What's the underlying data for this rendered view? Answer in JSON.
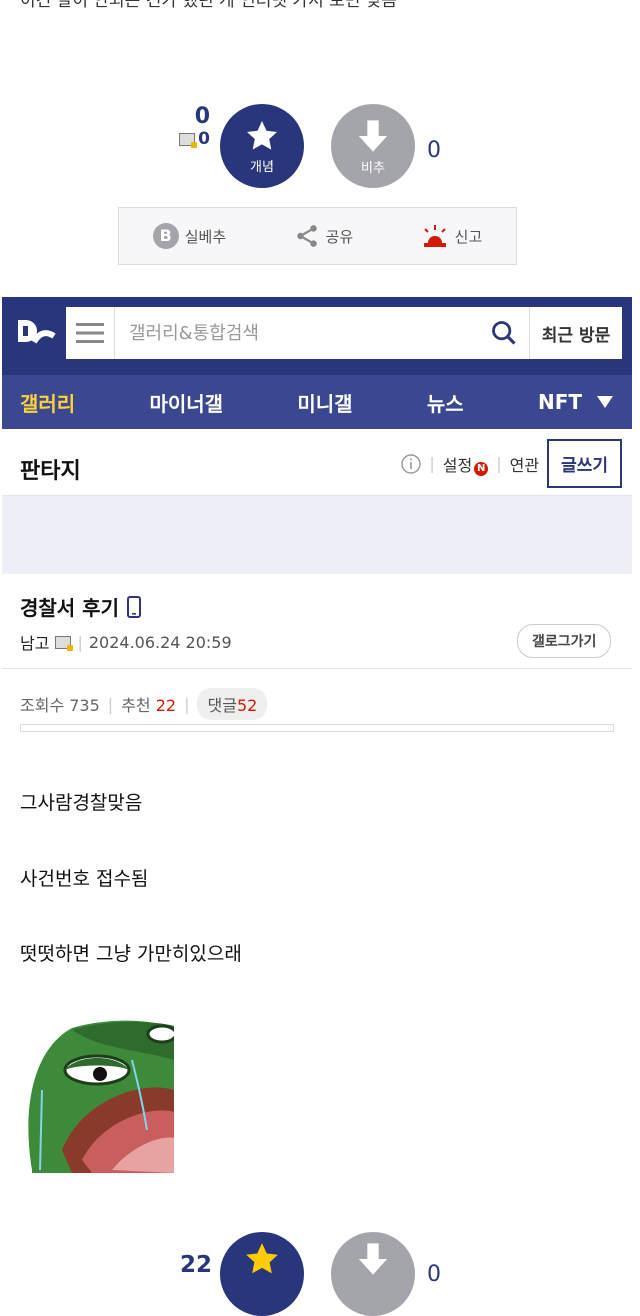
{
  "cut_off_text": "이건 말이 안되는 건가 했던 게 인터넷 가서 보면 맞음",
  "vote_top": {
    "up_count": "0",
    "up_fix_count": "0",
    "up_label": "개념",
    "down_label": "비추",
    "down_count": "0"
  },
  "actions": [
    {
      "label": "실베추",
      "icon": "b-badge-icon"
    },
    {
      "label": "공유",
      "icon": "share-icon"
    },
    {
      "label": "신고",
      "icon": "siren-icon"
    }
  ],
  "header": {
    "search_placeholder": "갤러리&통합검색",
    "recent_label": "최근 방문"
  },
  "nav": [
    "갤러리",
    "마이너갤",
    "미니갤",
    "뉴스",
    "NFT"
  ],
  "gallery": {
    "title": "판타지",
    "settings_label": "설정",
    "settings_badge": "N",
    "related_label": "연관",
    "write_label": "글쓰기"
  },
  "post": {
    "title": "경찰서 후기",
    "author": "남고",
    "date": "2024.06.24 20:59",
    "gallog_label": "갤로그가기",
    "views_label": "조회수 735",
    "recommend_label": "추천",
    "recommend_count": "22",
    "comment_label": "댓글",
    "comment_count": "52",
    "body": [
      "그사람경찰맞음",
      "사건번호 접수됨",
      "떳떳하면 그냥 가만히있으래"
    ]
  },
  "vote_bottom": {
    "up_count": "22",
    "down_count": "0"
  },
  "colors": {
    "brand": "#29367c",
    "nav_bg": "#3b4890",
    "active_nav": "#ffd23c",
    "accent_red": "#d31900"
  }
}
